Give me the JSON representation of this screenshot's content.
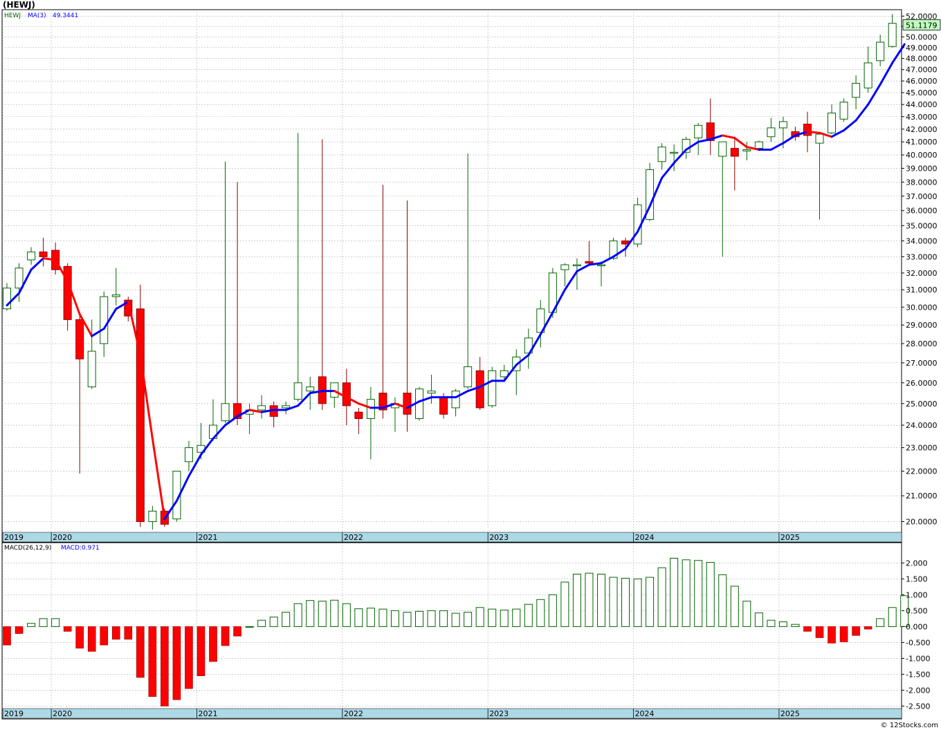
{
  "title": "(HEWJ)",
  "footer": "© 12Stocks.com",
  "colors": {
    "up": "#006400",
    "down": "#ff0000",
    "ma_up": "#0000ff",
    "ma_down": "#ff0000",
    "grid": "#b0b0b0",
    "date_strip": "#add8e6",
    "last_price_bg": "#bfffbf"
  },
  "chart_data": [
    {
      "type": "candlestick",
      "name": "price",
      "legend": {
        "symbol": "HEWJ",
        "ma_label": "MA(3)",
        "ma_value": "49.3441"
      },
      "last_price_label": "51.1179",
      "ylim": [
        19.6,
        52.5
      ],
      "y_scale": "log",
      "y_ticks": [
        20,
        21,
        22,
        23,
        24,
        25,
        26,
        27,
        28,
        29,
        30,
        31,
        32,
        33,
        34,
        35,
        36,
        37,
        38,
        39,
        40,
        41,
        42,
        43,
        44,
        45,
        46,
        47,
        48,
        49,
        50,
        51,
        52
      ],
      "x_labels": [
        {
          "i": 0,
          "label": "2019"
        },
        {
          "i": 4,
          "label": "2020"
        },
        {
          "i": 16,
          "label": "2021"
        },
        {
          "i": 28,
          "label": "2022"
        },
        {
          "i": 40,
          "label": "2023"
        },
        {
          "i": 52,
          "label": "2024"
        },
        {
          "i": 64,
          "label": "2025"
        }
      ],
      "candles": [
        {
          "o": 29.9,
          "h": 31.4,
          "l": 29.8,
          "c": 31.1
        },
        {
          "o": 31.1,
          "h": 32.6,
          "l": 30.3,
          "c": 32.3
        },
        {
          "o": 32.8,
          "h": 33.6,
          "l": 32.5,
          "c": 33.3
        },
        {
          "o": 33.3,
          "h": 34.2,
          "l": 32.4,
          "c": 33.0
        },
        {
          "o": 33.4,
          "h": 33.9,
          "l": 31.9,
          "c": 32.2
        },
        {
          "o": 32.4,
          "h": 32.6,
          "l": 28.7,
          "c": 29.3
        },
        {
          "o": 29.3,
          "h": 29.7,
          "l": 21.9,
          "c": 27.2
        },
        {
          "o": 25.8,
          "h": 29.3,
          "l": 25.7,
          "c": 27.6
        },
        {
          "o": 28.0,
          "h": 30.9,
          "l": 27.3,
          "c": 30.6
        },
        {
          "o": 30.6,
          "h": 32.3,
          "l": 30.1,
          "c": 30.7
        },
        {
          "o": 30.4,
          "h": 30.6,
          "l": 29.2,
          "c": 29.5
        },
        {
          "o": 29.9,
          "h": 31.3,
          "l": 19.8,
          "c": 20.0
        },
        {
          "o": 20.0,
          "h": 20.6,
          "l": 19.7,
          "c": 20.4
        },
        {
          "o": 20.4,
          "h": 20.5,
          "l": 19.8,
          "c": 19.9
        },
        {
          "o": 20.1,
          "h": 22.0,
          "l": 20.0,
          "c": 22.0
        },
        {
          "o": 22.4,
          "h": 23.3,
          "l": 22.0,
          "c": 23.0
        },
        {
          "o": 22.8,
          "h": 24.1,
          "l": 22.5,
          "c": 23.1
        },
        {
          "o": 23.4,
          "h": 25.2,
          "l": 23.3,
          "c": 24.0
        },
        {
          "o": 24.2,
          "h": 39.5,
          "l": 24.1,
          "c": 25.0
        },
        {
          "o": 25.0,
          "h": 38.0,
          "l": 24.0,
          "c": 24.3
        },
        {
          "o": 24.5,
          "h": 25.0,
          "l": 23.6,
          "c": 24.7
        },
        {
          "o": 24.7,
          "h": 25.4,
          "l": 24.3,
          "c": 24.9
        },
        {
          "o": 24.9,
          "h": 25.1,
          "l": 23.9,
          "c": 24.4
        },
        {
          "o": 24.8,
          "h": 25.1,
          "l": 24.5,
          "c": 24.9
        },
        {
          "o": 25.2,
          "h": 41.7,
          "l": 25.1,
          "c": 26.0
        },
        {
          "o": 25.6,
          "h": 26.3,
          "l": 24.7,
          "c": 25.8
        },
        {
          "o": 26.3,
          "h": 41.2,
          "l": 24.7,
          "c": 25.0
        },
        {
          "o": 25.3,
          "h": 26.0,
          "l": 24.8,
          "c": 26.0
        },
        {
          "o": 26.0,
          "h": 26.7,
          "l": 24.0,
          "c": 24.9
        },
        {
          "o": 24.6,
          "h": 24.8,
          "l": 23.6,
          "c": 24.3
        },
        {
          "o": 24.3,
          "h": 25.8,
          "l": 22.5,
          "c": 25.2
        },
        {
          "o": 25.5,
          "h": 37.8,
          "l": 24.3,
          "c": 24.7
        },
        {
          "o": 24.8,
          "h": 25.3,
          "l": 23.7,
          "c": 25.0
        },
        {
          "o": 25.5,
          "h": 36.7,
          "l": 23.7,
          "c": 24.5
        },
        {
          "o": 24.3,
          "h": 25.8,
          "l": 24.2,
          "c": 25.7
        },
        {
          "o": 25.5,
          "h": 26.4,
          "l": 25.0,
          "c": 25.6
        },
        {
          "o": 25.3,
          "h": 25.5,
          "l": 24.3,
          "c": 24.5
        },
        {
          "o": 24.8,
          "h": 25.7,
          "l": 24.4,
          "c": 25.6
        },
        {
          "o": 25.8,
          "h": 40.1,
          "l": 25.7,
          "c": 26.8
        },
        {
          "o": 26.6,
          "h": 27.3,
          "l": 24.7,
          "c": 24.8
        },
        {
          "o": 24.9,
          "h": 26.8,
          "l": 24.8,
          "c": 26.6
        },
        {
          "o": 26.3,
          "h": 26.9,
          "l": 26.1,
          "c": 26.6
        },
        {
          "o": 26.6,
          "h": 27.7,
          "l": 25.4,
          "c": 27.3
        },
        {
          "o": 27.5,
          "h": 28.8,
          "l": 26.7,
          "c": 28.3
        },
        {
          "o": 28.6,
          "h": 30.4,
          "l": 27.8,
          "c": 29.9
        },
        {
          "o": 29.7,
          "h": 32.3,
          "l": 29.4,
          "c": 32.0
        },
        {
          "o": 32.2,
          "h": 32.6,
          "l": 31.2,
          "c": 32.5
        },
        {
          "o": 32.5,
          "h": 32.9,
          "l": 31.0,
          "c": 32.5
        },
        {
          "o": 32.7,
          "h": 34.0,
          "l": 32.5,
          "c": 32.6
        },
        {
          "o": 32.5,
          "h": 32.7,
          "l": 31.2,
          "c": 32.5
        },
        {
          "o": 32.9,
          "h": 34.2,
          "l": 32.8,
          "c": 34.0
        },
        {
          "o": 34.0,
          "h": 34.2,
          "l": 33.0,
          "c": 33.8
        },
        {
          "o": 33.8,
          "h": 36.9,
          "l": 33.6,
          "c": 36.4
        },
        {
          "o": 35.4,
          "h": 39.4,
          "l": 35.3,
          "c": 38.9
        },
        {
          "o": 39.5,
          "h": 40.9,
          "l": 38.9,
          "c": 40.6
        },
        {
          "o": 40.2,
          "h": 40.8,
          "l": 38.8,
          "c": 40.2
        },
        {
          "o": 40.2,
          "h": 41.4,
          "l": 39.7,
          "c": 41.2
        },
        {
          "o": 41.3,
          "h": 42.5,
          "l": 40.0,
          "c": 42.3
        },
        {
          "o": 42.5,
          "h": 44.5,
          "l": 40.0,
          "c": 41.1
        },
        {
          "o": 39.9,
          "h": 41.0,
          "l": 33.0,
          "c": 41.0
        },
        {
          "o": 40.5,
          "h": 41.4,
          "l": 37.4,
          "c": 39.9
        },
        {
          "o": 40.3,
          "h": 41.0,
          "l": 39.6,
          "c": 40.4
        },
        {
          "o": 40.5,
          "h": 41.1,
          "l": 40.3,
          "c": 41.0
        },
        {
          "o": 41.4,
          "h": 42.9,
          "l": 41.0,
          "c": 42.1
        },
        {
          "o": 42.1,
          "h": 43.0,
          "l": 40.5,
          "c": 42.6
        },
        {
          "o": 41.8,
          "h": 42.2,
          "l": 41.1,
          "c": 41.4
        },
        {
          "o": 42.4,
          "h": 43.4,
          "l": 40.2,
          "c": 41.5
        },
        {
          "o": 40.9,
          "h": 41.5,
          "l": 35.4,
          "c": 41.6
        },
        {
          "o": 41.7,
          "h": 44.0,
          "l": 41.6,
          "c": 43.3
        },
        {
          "o": 42.8,
          "h": 44.5,
          "l": 42.6,
          "c": 44.2
        },
        {
          "o": 44.6,
          "h": 46.5,
          "l": 43.6,
          "c": 45.8
        },
        {
          "o": 45.4,
          "h": 49.1,
          "l": 45.0,
          "c": 47.6
        },
        {
          "o": 47.8,
          "h": 50.2,
          "l": 47.3,
          "c": 49.5
        },
        {
          "o": 49.1,
          "h": 52.2,
          "l": 49.0,
          "c": 51.3
        }
      ],
      "ma": [
        30.1,
        30.8,
        32.2,
        32.9,
        32.8,
        31.5,
        29.6,
        28.4,
        28.8,
        29.9,
        30.3,
        27.4,
        23.4,
        20.1,
        20.8,
        21.8,
        22.7,
        23.4,
        24.0,
        24.4,
        24.7,
        24.6,
        24.7,
        24.7,
        24.9,
        25.5,
        25.6,
        25.6,
        25.3,
        25.0,
        24.8,
        24.8,
        25.0,
        24.8,
        25.1,
        25.3,
        25.3,
        25.3,
        25.6,
        25.8,
        26.1,
        26.1,
        26.9,
        27.4,
        28.5,
        29.7,
        31.0,
        32.1,
        32.5,
        32.6,
        33.0,
        33.5,
        34.6,
        36.3,
        38.3,
        39.4,
        40.4,
        41.0,
        41.2,
        41.5,
        41.3,
        40.6,
        40.4,
        40.4,
        40.9,
        41.5,
        41.8,
        41.7,
        41.4,
        41.9,
        42.7,
        44.0,
        45.7,
        47.6,
        49.3
      ]
    },
    {
      "type": "bar",
      "name": "macd",
      "legend": {
        "label": "MACD(26,12,9)",
        "value_label": "MACD:0.971"
      },
      "ylim": [
        -2.6,
        2.4
      ],
      "y_ticks": [
        2.0,
        1.5,
        1.0,
        0.5,
        0.0,
        -0.5,
        -1.0,
        -1.5,
        -2.0,
        -2.5
      ],
      "y_tick_labels": [
        "2.000",
        "1.500",
        "1.000",
        "0.500",
        "0.000",
        "-0.500",
        "-1.000",
        "-1.500",
        "-2.000",
        "-2.500"
      ],
      "values": [
        -0.58,
        -0.22,
        0.1,
        0.25,
        0.25,
        -0.15,
        -0.68,
        -0.78,
        -0.58,
        -0.4,
        -0.4,
        -1.6,
        -2.2,
        -2.5,
        -2.3,
        -1.95,
        -1.55,
        -1.1,
        -0.6,
        -0.3,
        0.0,
        0.2,
        0.3,
        0.45,
        0.72,
        0.82,
        0.8,
        0.83,
        0.72,
        0.56,
        0.58,
        0.55,
        0.5,
        0.45,
        0.48,
        0.5,
        0.5,
        0.42,
        0.45,
        0.6,
        0.55,
        0.52,
        0.55,
        0.7,
        0.85,
        1.0,
        1.4,
        1.65,
        1.68,
        1.65,
        1.55,
        1.52,
        1.5,
        1.55,
        1.85,
        2.15,
        2.1,
        2.08,
        2.02,
        1.63,
        1.27,
        0.8,
        0.43,
        0.2,
        0.15,
        0.07,
        -0.15,
        -0.35,
        -0.52,
        -0.48,
        -0.28,
        -0.08,
        0.25,
        0.6,
        0.97
      ]
    }
  ]
}
